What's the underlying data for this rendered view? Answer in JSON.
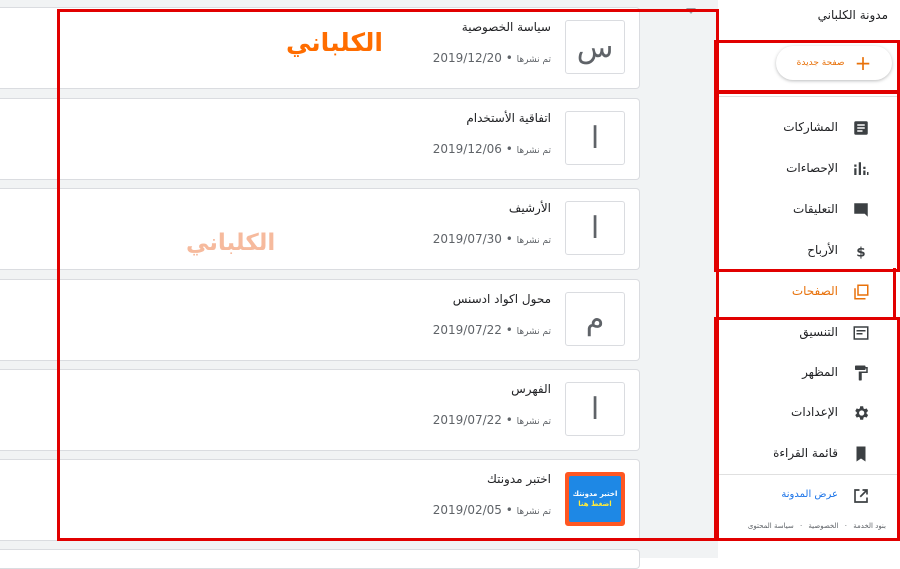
{
  "sidebar": {
    "blog_title": "مدونة الكلباني",
    "new_page": "صفحة جديدة",
    "nav": [
      {
        "label": "المشاركات",
        "icon": "posts-icon"
      },
      {
        "label": "الإحصاءات",
        "icon": "stats-icon"
      },
      {
        "label": "التعليقات",
        "icon": "comments-icon"
      },
      {
        "label": "الأرباح",
        "icon": "dollar-icon"
      },
      {
        "label": "الصفحات",
        "icon": "pages-icon",
        "active": true
      },
      {
        "label": "التنسيق",
        "icon": "layout-icon"
      },
      {
        "label": "المظهر",
        "icon": "paint-roller-icon"
      },
      {
        "label": "الإعدادات",
        "icon": "gear-icon"
      },
      {
        "label": "قائمة القراءة",
        "icon": "bookmark-icon"
      }
    ],
    "view_blog": "عرض المدونة",
    "footer": {
      "terms": "بنود الخدمة",
      "privacy": "الخصوصية",
      "content_policy": "سياسة المحتوى",
      "dot": "·"
    }
  },
  "pages": [
    {
      "title": "سياسة الخصوصية",
      "status": "تم نشرها",
      "date": "2019/12/20",
      "thumb": "س"
    },
    {
      "title": "اتفاقية الأستخدام",
      "status": "تم نشرها",
      "date": "2019/12/06",
      "thumb": "ا"
    },
    {
      "title": "الأرشيف",
      "status": "تم نشرها",
      "date": "2019/07/30",
      "thumb": "ا"
    },
    {
      "title": "محول اكواد ادسنس",
      "status": "تم نشرها",
      "date": "2019/07/22",
      "thumb": "م"
    },
    {
      "title": "الفهرس",
      "status": "تم نشرها",
      "date": "2019/07/22",
      "thumb": "ا"
    },
    {
      "title": "اختبر مدونتك",
      "status": "تم نشرها",
      "date": "2019/02/05",
      "thumb_line1": "اختبر مدونتك",
      "thumb_line2": "اضغط هنا"
    }
  ],
  "watermark": "الكلباني",
  "colors": {
    "accent": "#e8710a",
    "annotation": "#e10000",
    "link": "#1a73e8"
  }
}
